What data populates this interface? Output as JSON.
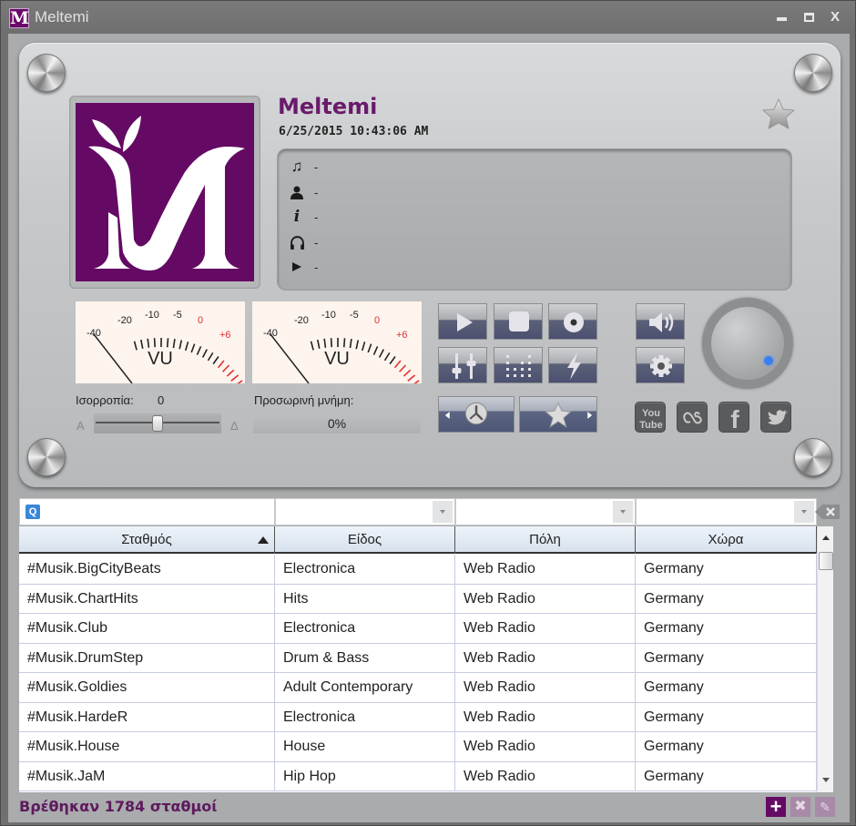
{
  "window": {
    "title": "Meltemi",
    "app_icon_letter": "M",
    "controls": {
      "minimize": "minimize",
      "maximize": "maximize",
      "close": "X"
    }
  },
  "player": {
    "station_name": "Meltemi",
    "datetime": "6/25/2015 10:43:06 AM",
    "info": [
      {
        "icon": "music-note-icon",
        "value": "-"
      },
      {
        "icon": "artist-icon",
        "value": "-"
      },
      {
        "icon": "info-icon",
        "value": "-"
      },
      {
        "icon": "headphones-icon",
        "value": "-"
      },
      {
        "icon": "play-small-icon",
        "value": "-"
      }
    ],
    "vu_meter": {
      "label": "VU",
      "scale_labels": [
        "-40",
        "-20",
        "-10",
        "-5",
        "0",
        "+6"
      ],
      "normal_color": "#222222",
      "peak_color": "#e03030"
    },
    "balance": {
      "label": "Ισορροπία:",
      "value": "0",
      "left_label": "Α",
      "right_label": "Δ",
      "position": 0.5
    },
    "buffer": {
      "label": "Προσωρινή μνήμη:",
      "value": "0%",
      "progress": 0
    },
    "volume": {
      "level": 0.65
    },
    "buttons": [
      "play",
      "stop",
      "record",
      "mute",
      "equalizer",
      "visualizer",
      "effects",
      "settings",
      "history",
      "favorites"
    ],
    "social": [
      "YouTube",
      "Last.fm",
      "Facebook",
      "Twitter"
    ],
    "social_labels": {
      "youtube_top": "You",
      "youtube_bottom": "Tube",
      "facebook": "f"
    }
  },
  "filters": {
    "search_placeholder": "",
    "search_value": "",
    "genre": "",
    "city": "",
    "country": ""
  },
  "table": {
    "columns": [
      "Σταθμός",
      "Είδος",
      "Πόλη",
      "Χώρα"
    ],
    "sort_column": "Σταθμός",
    "sort_direction": "asc",
    "rows": [
      [
        "#Musik.BigCityBeats",
        "Electronica",
        "Web Radio",
        "Germany"
      ],
      [
        "#Musik.ChartHits",
        "Hits",
        "Web Radio",
        "Germany"
      ],
      [
        "#Musik.Club",
        "Electronica",
        "Web Radio",
        "Germany"
      ],
      [
        "#Musik.DrumStep",
        "Drum & Bass",
        "Web Radio",
        "Germany"
      ],
      [
        "#Musik.Goldies",
        "Adult Contemporary",
        "Web Radio",
        "Germany"
      ],
      [
        "#Musik.HardeR",
        "Electronica",
        "Web Radio",
        "Germany"
      ],
      [
        "#Musik.House",
        "House",
        "Web Radio",
        "Germany"
      ],
      [
        "#Musik.JaM",
        "Hip Hop",
        "Web Radio",
        "Germany"
      ]
    ]
  },
  "status": {
    "text": "Βρέθηκαν 1784 σταθμοί",
    "add_label": "+",
    "delete_label": "✖",
    "edit_label": "✎"
  },
  "colors": {
    "brand_purple": "#640a64",
    "accent_blue": "#3a7ff0",
    "button_navy": "#4b5070"
  }
}
